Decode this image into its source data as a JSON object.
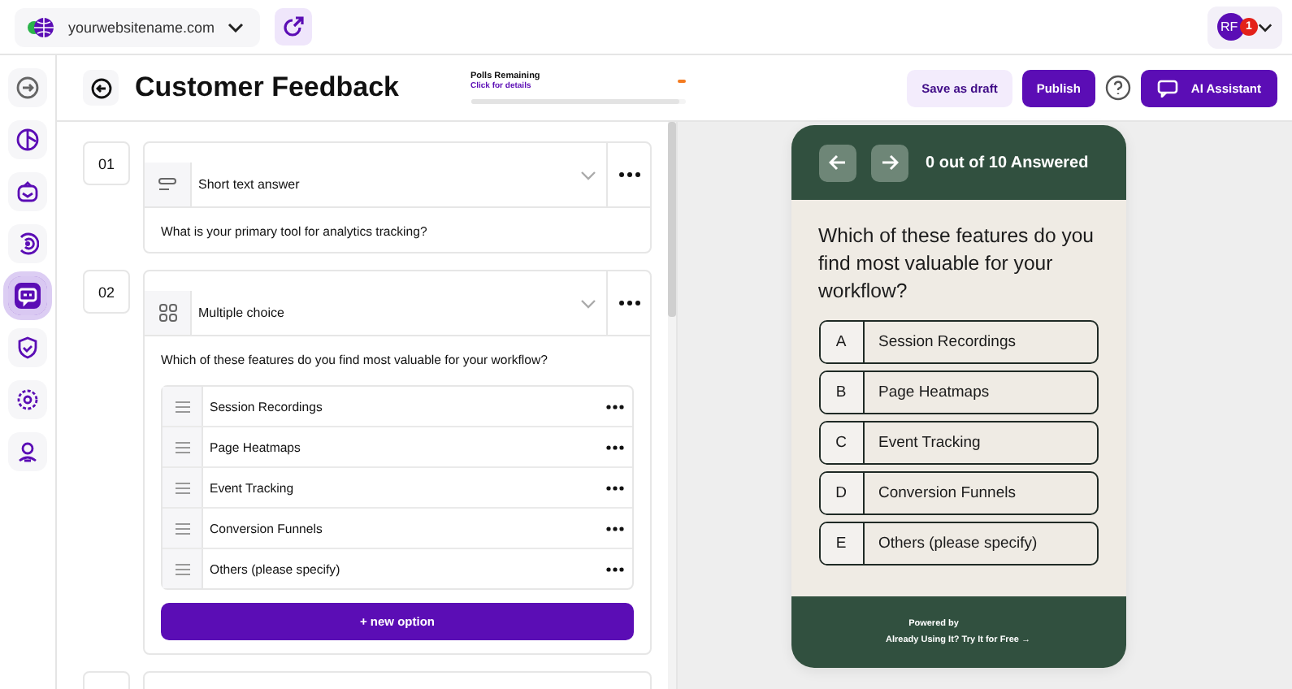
{
  "top_bar": {
    "site": "yourwebsitename.com",
    "avatar": {
      "initials": "RF",
      "badge": "1"
    }
  },
  "sidebar": {
    "items": [
      {
        "selected": false
      },
      {
        "selected": false
      },
      {
        "selected": false
      },
      {
        "selected": false
      },
      {
        "selected": true
      },
      {
        "selected": false
      },
      {
        "selected": false
      },
      {
        "selected": false
      }
    ]
  },
  "header": {
    "title": "Customer Feedback",
    "polls": {
      "label": "Polls Remaining",
      "link": "Click for details",
      "level": 0.97
    },
    "save_draft": "Save as draft",
    "publish": "Publish",
    "ai_assistant": "AI Assistant"
  },
  "questions": [
    {
      "number": "01",
      "kind": "short_text",
      "type": "Short text answer",
      "text": "What is your primary tool for analytics tracking?"
    },
    {
      "number": "02",
      "kind": "multiple_choice",
      "type": "Multiple choice",
      "text": "Which of these features do you find most valuable for your workflow?",
      "options": [
        "Session Recordings",
        "Page Heatmaps",
        "Event Tracking",
        "Conversion Funnels",
        "Others (please specify)"
      ],
      "add_option": "+ new option"
    }
  ],
  "preview": {
    "progress": "0 out of 10 Answered",
    "question": "Which of these features do you find most valuable for your workflow?",
    "options": [
      {
        "letter": "A",
        "label": "Session Recordings"
      },
      {
        "letter": "B",
        "label": "Page Heatmaps"
      },
      {
        "letter": "C",
        "label": "Event Tracking"
      },
      {
        "letter": "D",
        "label": "Conversion Funnels"
      },
      {
        "letter": "E",
        "label": "Others (please specify)"
      }
    ],
    "powered_by": "Powered by",
    "cta": "Already Using It? Try It for Free →"
  }
}
